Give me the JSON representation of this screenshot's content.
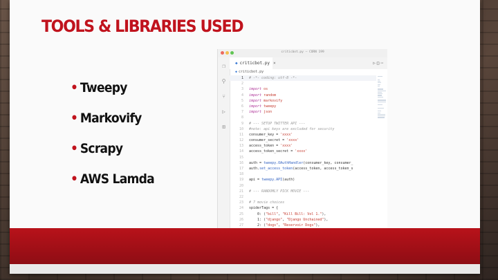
{
  "slide": {
    "title": "TOOLS & LIBRARIES USED",
    "bullet_marker": "•",
    "bullets": [
      "Tweepy",
      "Markovify",
      "Scrapy",
      "AWS Lamda"
    ]
  },
  "editor": {
    "window_title": "criticbot.py — CORN 199",
    "tab_label": "criticbot.py",
    "tab_close": "×",
    "breadcrumb": "criticbot.py",
    "toolbar_icons": [
      "run-icon",
      "split-editor-icon",
      "more-icon"
    ],
    "activity_icons": [
      "files-icon",
      "search-icon",
      "source-control-icon",
      "debug-icon",
      "extensions-icon"
    ],
    "traffic_light_colors": [
      "#ec6a5e",
      "#f4bf4f",
      "#61c554"
    ],
    "current_line": 1,
    "code_lines": [
      [
        {
          "t": "# -*- coding: utf-8 -*-",
          "c": "cm"
        }
      ],
      [],
      [
        {
          "t": "import",
          "c": "kw"
        },
        {
          "t": " os",
          "c": "st"
        }
      ],
      [
        {
          "t": "import",
          "c": "kw"
        },
        {
          "t": " random",
          "c": "st"
        }
      ],
      [
        {
          "t": "import",
          "c": "kw"
        },
        {
          "t": " markovify",
          "c": "st"
        }
      ],
      [
        {
          "t": "import",
          "c": "kw"
        },
        {
          "t": " tweepy",
          "c": "st"
        }
      ],
      [
        {
          "t": "import",
          "c": "kw"
        },
        {
          "t": " json",
          "c": "st"
        }
      ],
      [],
      [
        {
          "t": "# --- SETUP TWITTER API ---",
          "c": "cm"
        }
      ],
      [
        {
          "t": "#note: api keys are excluded for security",
          "c": "cm"
        }
      ],
      [
        {
          "t": "consumer_key = ",
          "c": "txt"
        },
        {
          "t": "'xxxx'",
          "c": "st"
        }
      ],
      [
        {
          "t": "consumer_secret = ",
          "c": "txt"
        },
        {
          "t": "'xxxx'",
          "c": "st"
        }
      ],
      [
        {
          "t": "access_token = ",
          "c": "txt"
        },
        {
          "t": "'xxxx'",
          "c": "st"
        }
      ],
      [
        {
          "t": "access_token_secret = ",
          "c": "txt"
        },
        {
          "t": "'xxxx'",
          "c": "st"
        }
      ],
      [],
      [
        {
          "t": "auth = ",
          "c": "txt"
        },
        {
          "t": "tweepy.OAuthHandler",
          "c": "fn"
        },
        {
          "t": "(consumer_key, consumer_",
          "c": "txt"
        }
      ],
      [
        {
          "t": "auth.",
          "c": "txt"
        },
        {
          "t": "set_access_token",
          "c": "fn"
        },
        {
          "t": "(access_token, access_token_s",
          "c": "txt"
        }
      ],
      [],
      [
        {
          "t": "api = ",
          "c": "txt"
        },
        {
          "t": "tweepy.API",
          "c": "fn"
        },
        {
          "t": "(auth)",
          "c": "txt"
        }
      ],
      [],
      [
        {
          "t": "# --- RANDOMLY PICK MOVIE ---",
          "c": "cm"
        }
      ],
      [],
      [
        {
          "t": "# 7 movie choices",
          "c": "cm"
        }
      ],
      [
        {
          "t": "spiderTags = {",
          "c": "txt"
        }
      ],
      [
        {
          "t": "    0: (",
          "c": "txt"
        },
        {
          "t": "\"bill\"",
          "c": "st"
        },
        {
          "t": ", ",
          "c": "txt"
        },
        {
          "t": "\"Kill Bill: Vol 1.\"",
          "c": "st"
        },
        {
          "t": "),",
          "c": "txt"
        }
      ],
      [
        {
          "t": "    1: (",
          "c": "txt"
        },
        {
          "t": "\"django\"",
          "c": "st"
        },
        {
          "t": ", ",
          "c": "txt"
        },
        {
          "t": "\"Django Unchained\"",
          "c": "st"
        },
        {
          "t": "),",
          "c": "txt"
        }
      ],
      [
        {
          "t": "    2: (",
          "c": "txt"
        },
        {
          "t": "\"dogs\"",
          "c": "st"
        },
        {
          "t": ", ",
          "c": "txt"
        },
        {
          "t": "\"Reservoir Dogs\"",
          "c": "st"
        },
        {
          "t": "),",
          "c": "txt"
        }
      ]
    ],
    "brand_red": "#c0131d"
  }
}
